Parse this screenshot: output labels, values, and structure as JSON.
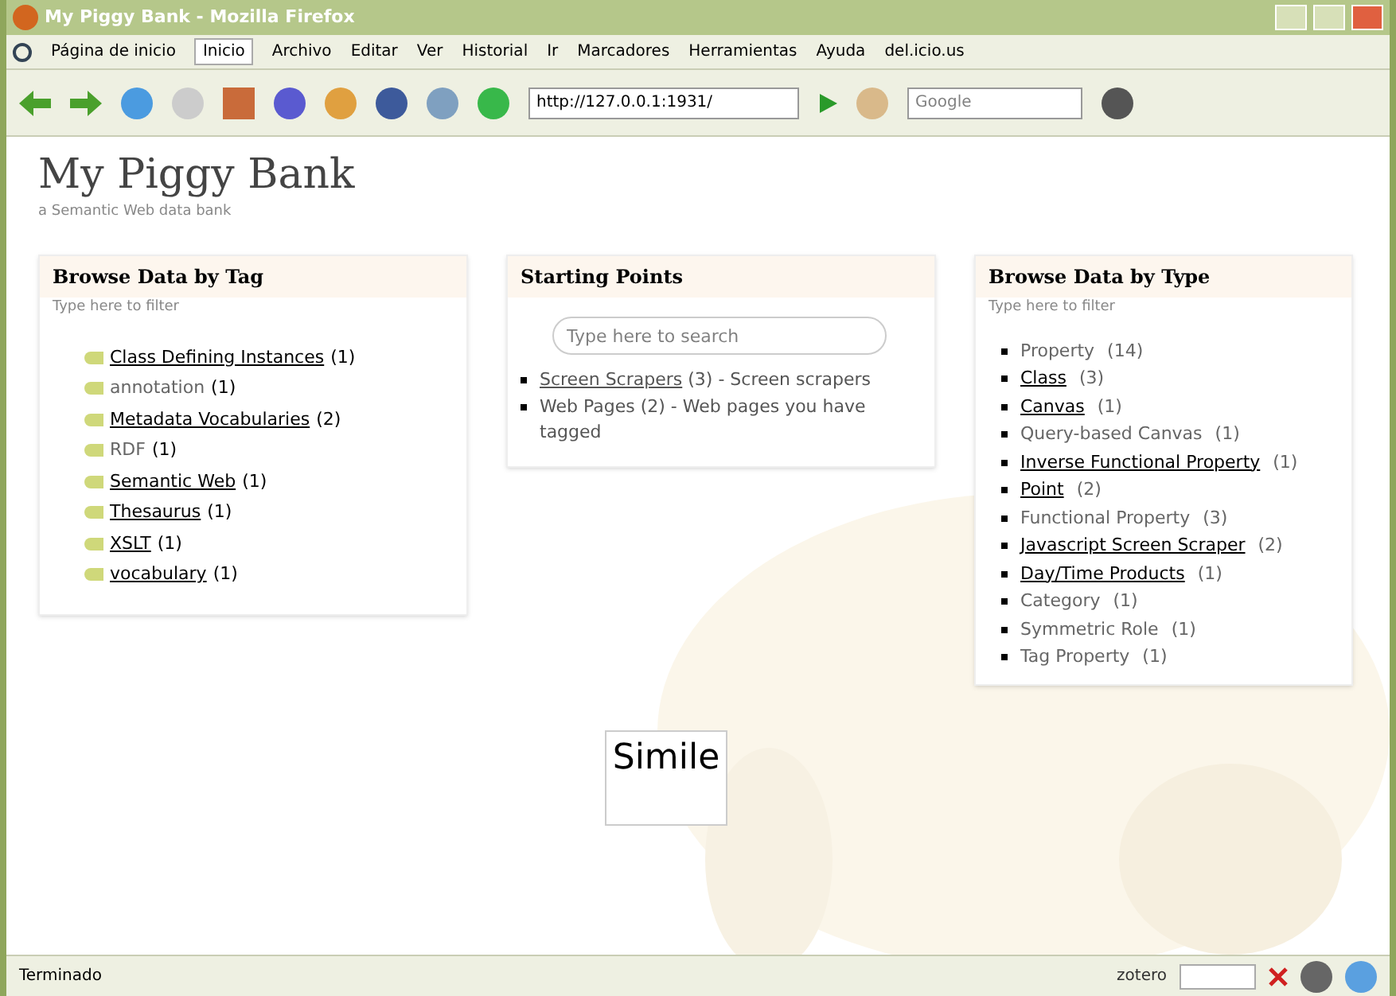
{
  "window": {
    "title": "My Piggy Bank - Mozilla Firefox"
  },
  "menu_bar": {
    "bookmarks": [
      "Página de inicio",
      "Inicio"
    ],
    "items": [
      "Archivo",
      "Editar",
      "Ver",
      "Historial",
      "Ir",
      "Marcadores",
      "Herramientas",
      "Ayuda",
      "del.icio.us"
    ]
  },
  "nav_toolbar": {
    "address": "http://127.0.0.1:1931/",
    "search": {
      "placeholder": "Google"
    }
  },
  "page": {
    "title": "My Piggy Bank",
    "subtitle": "a Semantic Web data bank",
    "tag_panel": {
      "title": "Browse Data by Tag",
      "filter_hint": "Type here to filter",
      "tags": [
        {
          "label": "Class Defining Instances",
          "count": "(1)",
          "linked": true
        },
        {
          "label": "annotation",
          "count": "(1)",
          "linked": false
        },
        {
          "label": "Metadata Vocabularies",
          "count": "(2)",
          "linked": true
        },
        {
          "label": "RDF",
          "count": "(1)",
          "linked": false
        },
        {
          "label": "Semantic Web",
          "count": "(1)",
          "linked": true
        },
        {
          "label": "Thesaurus",
          "count": "(1)",
          "linked": true
        },
        {
          "label": "XSLT",
          "count": "(1)",
          "linked": true
        },
        {
          "label": "vocabulary",
          "count": "(1)",
          "linked": true
        }
      ]
    },
    "start_panel": {
      "title": "Starting Points",
      "search": {
        "placeholder": "Type here to search"
      },
      "items": [
        {
          "link": "Screen Scrapers",
          "rest": "(3) - Screen scrapers",
          "linked": true
        },
        {
          "link": "Web Pages",
          "rest": "(2) - Web pages you have tagged",
          "linked": false
        }
      ]
    },
    "type_panel": {
      "title": "Browse Data by Type",
      "filter_hint": "Type here to filter",
      "types": [
        {
          "label": "Property",
          "count": "(14)",
          "linked": false
        },
        {
          "label": "Class",
          "count": "(3)",
          "linked": true
        },
        {
          "label": "Canvas",
          "count": "(1)",
          "linked": true
        },
        {
          "label": "Query-based Canvas",
          "count": "(1)",
          "linked": false
        },
        {
          "label": "Inverse Functional Property",
          "count": "(1)",
          "linked": true
        },
        {
          "label": "Point",
          "count": "(2)",
          "linked": true
        },
        {
          "label": "Functional Property",
          "count": "(3)",
          "linked": false
        },
        {
          "label": "Javascript Screen Scraper",
          "count": "(2)",
          "linked": true
        },
        {
          "label": "Day/Time Products",
          "count": "(1)",
          "linked": true
        },
        {
          "label": "Category",
          "count": "(1)",
          "linked": false
        },
        {
          "label": "Symmetric Role",
          "count": "(1)",
          "linked": false
        },
        {
          "label": "Tag Property",
          "count": "(1)",
          "linked": false
        }
      ]
    },
    "logo": "Simile"
  },
  "status_bar": {
    "text": "Terminado",
    "zotero": "zotero"
  }
}
